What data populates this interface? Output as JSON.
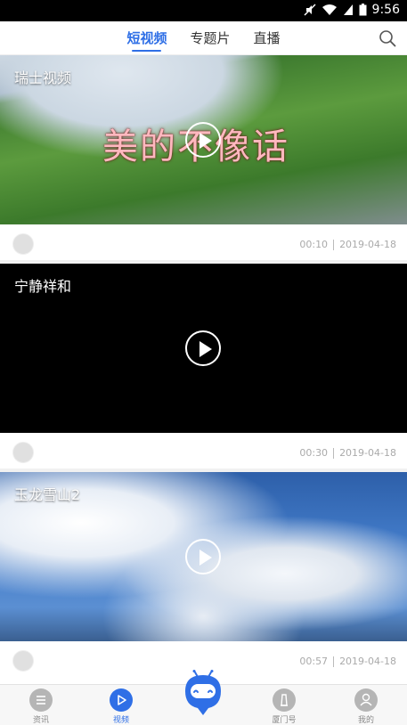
{
  "status_bar": {
    "time": "9:56"
  },
  "top_nav": {
    "tabs": [
      {
        "label": "短视频",
        "active": true
      },
      {
        "label": "专题片",
        "active": false
      },
      {
        "label": "直播",
        "active": false
      }
    ]
  },
  "feed": [
    {
      "title": "瑞士视频",
      "overlay_text": "美的不像话",
      "duration": "00:10",
      "date": "2019-04-18"
    },
    {
      "title": "宁静祥和",
      "duration": "00:30",
      "date": "2019-04-18"
    },
    {
      "title": "玉龙雪山2",
      "duration": "00:57",
      "date": "2019-04-18"
    }
  ],
  "bottom_nav": {
    "items": [
      {
        "label": "资讯",
        "active": false
      },
      {
        "label": "视频",
        "active": true
      },
      {
        "label": "厦门号",
        "active": false
      },
      {
        "label": "我的",
        "active": false
      }
    ]
  },
  "colors": {
    "accent": "#2f6fe6"
  }
}
